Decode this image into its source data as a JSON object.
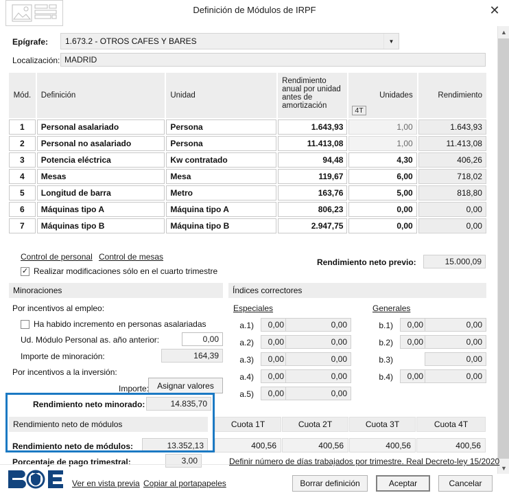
{
  "window": {
    "title": "Definición de Módulos de IRPF",
    "close_label": "✕",
    "app_icon": "document-image-icon"
  },
  "form": {
    "epigrafe_label": "Epígrafe:",
    "epigrafe_value": "1.673.2 - OTROS CAFES Y BARES",
    "localizacion_label": "Localización:",
    "localizacion_value": "MADRID"
  },
  "table": {
    "headers": {
      "mod": "Mód.",
      "definicion": "Definición",
      "unidad": "Unidad",
      "rendimiento_unidad": "Rendimiento anual por unidad antes de amortización",
      "unidades": "Unidades",
      "rendimiento": "Rendimiento",
      "trimestre_badge": "4T"
    },
    "rows": [
      {
        "mod": "1",
        "definicion": "Personal asalariado",
        "unidad": "Persona",
        "rend_unidad": "1.643,93",
        "unidades": "1,00",
        "rendimiento": "1.643,93",
        "unidades_readonly": true
      },
      {
        "mod": "2",
        "definicion": "Personal no asalariado",
        "unidad": "Persona",
        "rend_unidad": "11.413,08",
        "unidades": "1,00",
        "rendimiento": "11.413,08",
        "unidades_readonly": true
      },
      {
        "mod": "3",
        "definicion": "Potencia eléctrica",
        "unidad": "Kw contratado",
        "rend_unidad": "94,48",
        "unidades": "4,30",
        "rendimiento": "406,26",
        "unidades_readonly": false
      },
      {
        "mod": "4",
        "definicion": "Mesas",
        "unidad": "Mesa",
        "rend_unidad": "119,67",
        "unidades": "6,00",
        "rendimiento": "718,02",
        "unidades_readonly": false
      },
      {
        "mod": "5",
        "definicion": "Longitud de barra",
        "unidad": "Metro",
        "rend_unidad": "163,76",
        "unidades": "5,00",
        "rendimiento": "818,80",
        "unidades_readonly": false
      },
      {
        "mod": "6",
        "definicion": "Máquinas tipo A",
        "unidad": "Máquina tipo A",
        "rend_unidad": "806,23",
        "unidades": "0,00",
        "rendimiento": "0,00",
        "unidades_readonly": false
      },
      {
        "mod": "7",
        "definicion": "Máquinas tipo B",
        "unidad": "Máquina tipo B",
        "rend_unidad": "2.947,75",
        "unidades": "0,00",
        "rendimiento": "0,00",
        "unidades_readonly": false
      }
    ]
  },
  "controls": {
    "control_personal": "Control de personal",
    "control_mesas": "Control de mesas",
    "cuarto_trimestre_label": "Realizar modificaciones sólo en el cuarto trimestre",
    "cuarto_trimestre_checked": true,
    "check_mark": "✓",
    "rendimiento_neto_previo_label": "Rendimiento neto previo:",
    "rendimiento_neto_previo_value": "15.000,09"
  },
  "minoraciones": {
    "header": "Minoraciones",
    "incentivos_empleo_label": "Por incentivos al empleo:",
    "incremento_label": "Ha habido incremento en personas asalariadas",
    "incremento_checked": false,
    "ud_modulo_label": "Ud. Módulo Personal as. año anterior:",
    "ud_modulo_value": "0,00",
    "importe_minoracion_label": "Importe de minoración:",
    "importe_minoracion_value": "164,39",
    "incentivos_inversion_label": "Por incentivos a la inversión:",
    "importe_label": "Importe:",
    "asignar_valores_button": "Asignar valores",
    "rendimiento_neto_minorado_label": "Rendimiento neto minorado:",
    "rendimiento_neto_minorado_value": "14.835,70"
  },
  "indices": {
    "header": "Índices correctores",
    "especiales_label": "Especiales",
    "generales_label": "Generales",
    "especiales": [
      {
        "key": "a.1)",
        "index": "0,00",
        "amount": "0,00",
        "has_index": true
      },
      {
        "key": "a.2)",
        "index": "0,00",
        "amount": "0,00",
        "has_index": true
      },
      {
        "key": "a.3)",
        "index": "0,00",
        "amount": "0,00",
        "has_index": true
      },
      {
        "key": "a.4)",
        "index": "0,00",
        "amount": "0,00",
        "has_index": true
      },
      {
        "key": "a.5)",
        "index": "0,00",
        "amount": "0,00",
        "has_index": true
      }
    ],
    "generales": [
      {
        "key": "b.1)",
        "index": "0,00",
        "amount": "0,00",
        "has_index": true
      },
      {
        "key": "b.2)",
        "index": "0,00",
        "amount": "0,00",
        "has_index": true
      },
      {
        "key": "b.3)",
        "index": "",
        "amount": "0,00",
        "has_index": false
      },
      {
        "key": "b.4)",
        "index": "0,00",
        "amount": "0,00",
        "has_index": true
      }
    ]
  },
  "modulos": {
    "section_header": "Rendimiento neto de módulos",
    "field_label": "Rendimiento neto de módulos:",
    "field_value": "13.352,13",
    "porcentaje_label": "Porcentaje de pago trimestral:",
    "porcentaje_value": "3,00"
  },
  "cuotas": {
    "headers": [
      "Cuota 1T",
      "Cuota 2T",
      "Cuota 3T",
      "Cuota 4T"
    ],
    "values": [
      "400,56",
      "400,56",
      "400,56",
      "400,56"
    ],
    "dias_link": "Definir número de días trabajados por trimestre. Real Decreto-ley 15/2020"
  },
  "footer": {
    "logo": "boe-logo",
    "vista_previa_link": "Ver en vista previa",
    "portapapeles_link": "Copiar al portapapeles",
    "borrar_button": "Borrar definición",
    "aceptar_button": "Aceptar",
    "cancelar_button": "Cancelar"
  },
  "colors": {
    "highlight": "#1b79c3",
    "boe_blue": "#12447e",
    "panel_gray": "#ededed"
  }
}
